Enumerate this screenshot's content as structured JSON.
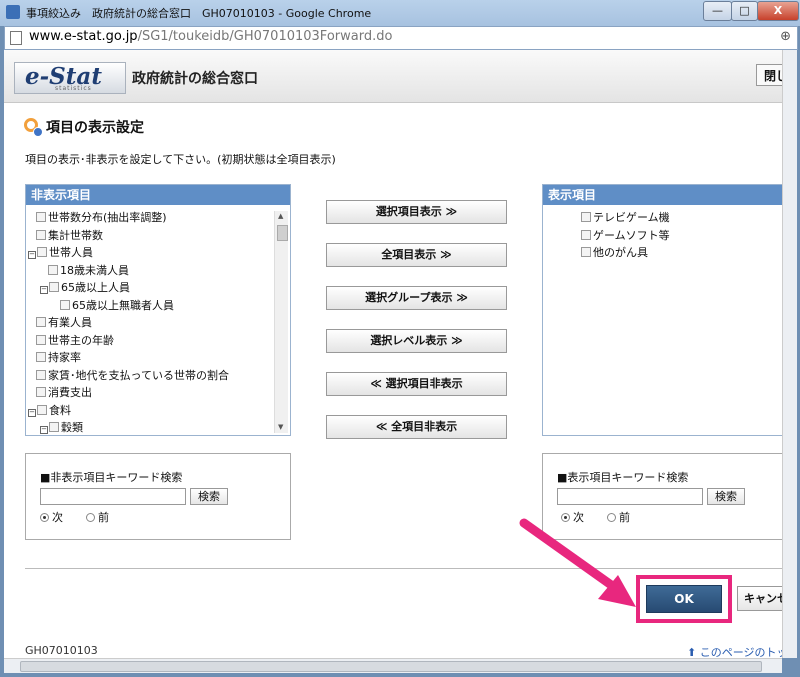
{
  "window": {
    "title": "事項絞込み　政府統計の総合窓口　GH07010103 - Google Chrome",
    "min_label": "—",
    "max_label": "□",
    "close_label": "X"
  },
  "address": {
    "domain": "www.e-stat.go.jp",
    "path": "/SG1/toukeidb/GH07010103Forward.do",
    "zoom_icon": "⊕"
  },
  "header": {
    "logo_text": "e-Stat",
    "logo_sub": "statistics",
    "site_title": "政府統計の総合窓口",
    "close_button": "閉じ"
  },
  "section": {
    "title": "項目の表示設定",
    "description": "項目の表示･非表示を設定して下さい。(初期状態は全項目表示)"
  },
  "hidden_panel": {
    "header": "非表示項目",
    "items": [
      {
        "label": "世帯数分布(抽出率調整)",
        "indent": 0,
        "expander": ""
      },
      {
        "label": "集計世帯数",
        "indent": 0,
        "expander": ""
      },
      {
        "label": "世帯人員",
        "indent": 0,
        "expander": "−"
      },
      {
        "label": "18歳未満人員",
        "indent": 1,
        "expander": ""
      },
      {
        "label": "65歳以上人員",
        "indent": 1,
        "expander": "−"
      },
      {
        "label": "65歳以上無職者人員",
        "indent": 2,
        "expander": ""
      },
      {
        "label": "有業人員",
        "indent": 0,
        "expander": ""
      },
      {
        "label": "世帯主の年齢",
        "indent": 0,
        "expander": ""
      },
      {
        "label": "持家率",
        "indent": 0,
        "expander": ""
      },
      {
        "label": "家賃･地代を支払っている世帯の割合",
        "indent": 0,
        "expander": ""
      },
      {
        "label": "消費支出",
        "indent": 0,
        "expander": ""
      },
      {
        "label": "食料",
        "indent": 0,
        "expander": "−"
      },
      {
        "label": "穀類",
        "indent": 1,
        "expander": "−"
      }
    ]
  },
  "shown_panel": {
    "header": "表示項目",
    "items": [
      {
        "label": "テレビゲーム機"
      },
      {
        "label": "ゲームソフト等"
      },
      {
        "label": "他のがん具"
      }
    ]
  },
  "buttons": {
    "show_selected": "選択項目表示 ≫",
    "show_all": "全項目表示 ≫",
    "show_group": "選択グループ表示 ≫",
    "show_level": "選択レベル表示 ≫",
    "hide_selected": "≪ 選択項目非表示",
    "hide_all": "≪ 全項目非表示"
  },
  "search_hidden": {
    "title": "■非表示項目キーワード検索",
    "value": "",
    "button": "検索",
    "next": "次",
    "prev": "前",
    "selected": "next"
  },
  "search_shown": {
    "title": "■表示項目キーワード検索",
    "value": "",
    "button": "検索",
    "next": "次",
    "prev": "前",
    "selected": "next"
  },
  "actions": {
    "ok": "OK",
    "cancel": "キャンセ"
  },
  "footer": {
    "code": "GH07010103",
    "top_link": "このページのトップ"
  },
  "colors": {
    "panel_header": "#5f8ec6",
    "highlight": "#e8277e",
    "ok_button": "#2f5882"
  }
}
